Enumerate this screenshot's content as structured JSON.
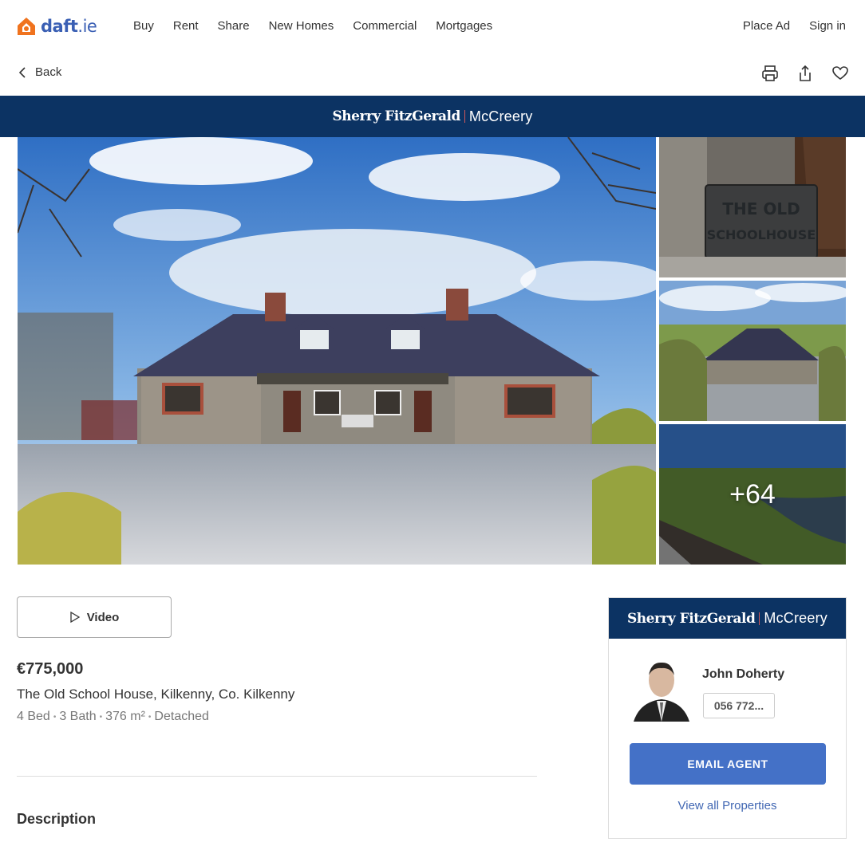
{
  "nav": {
    "logo_text": "daft",
    "logo_suffix": ".ie",
    "links": [
      "Buy",
      "Rent",
      "Share",
      "New Homes",
      "Commercial",
      "Mortgages"
    ],
    "place_ad": "Place Ad",
    "sign_in": "Sign in"
  },
  "backbar": {
    "back_label": "Back"
  },
  "brand": {
    "name_left": "Sherry FitzGerald",
    "name_right": "McCreery"
  },
  "gallery": {
    "sign_line1": "THE OLD",
    "sign_line2": "SCHOOLHOUSE",
    "more_count": "+64"
  },
  "listing": {
    "video_label": "Video",
    "price": "€775,000",
    "address": "The Old School House, Kilkenny, Co. Kilkenny",
    "beds": "4 Bed",
    "baths": "3 Bath",
    "area": "376 m²",
    "type": "Detached",
    "description_heading": "Description"
  },
  "agent": {
    "name": "John Doherty",
    "phone": "056 772...",
    "email_label": "EMAIL AGENT",
    "view_all_label": "View all Properties"
  },
  "colors": {
    "brand_navy": "#0c3363",
    "daft_blue": "#3a5fb4",
    "daft_orange": "#f0731e",
    "email_button": "#4471c7",
    "link_blue": "#4167b3"
  },
  "icons": [
    "house-logo-icon",
    "chevron-left-icon",
    "print-icon",
    "share-icon",
    "heart-icon",
    "play-icon"
  ]
}
